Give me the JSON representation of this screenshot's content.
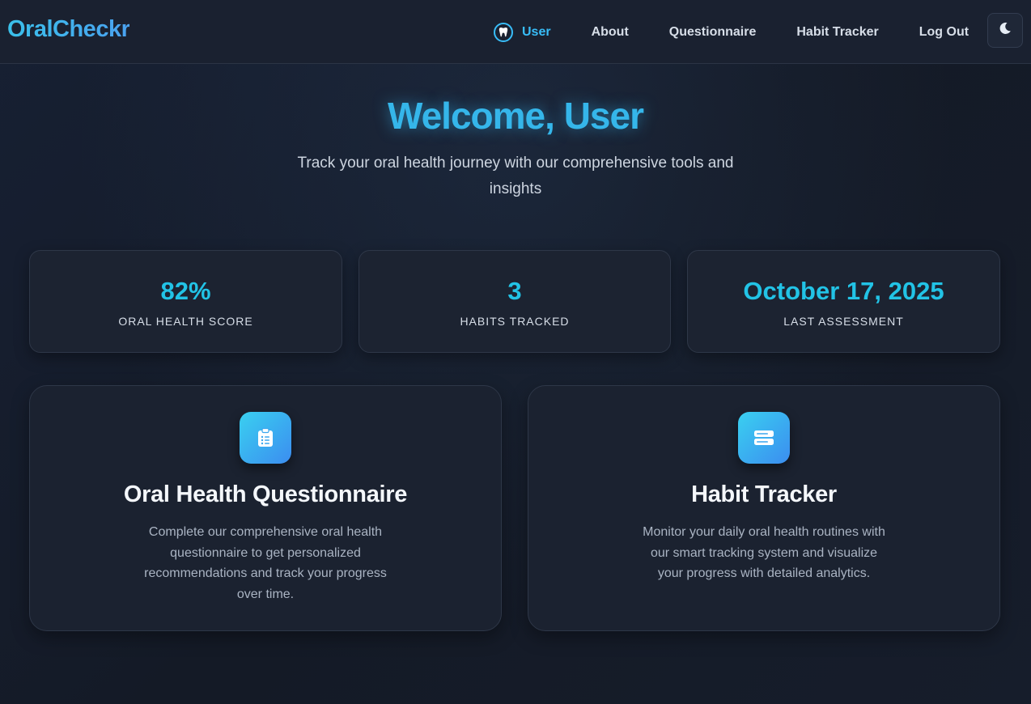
{
  "brand": "OralCheckr",
  "nav": {
    "user": "User",
    "about": "About",
    "questionnaire": "Questionnaire",
    "habit_tracker": "Habit Tracker",
    "logout": "Log Out"
  },
  "hero": {
    "title": "Welcome, User",
    "subtitle": "Track your oral health journey with our comprehensive tools and insights"
  },
  "stats": [
    {
      "value": "82%",
      "label": "Oral Health Score"
    },
    {
      "value": "3",
      "label": "Habits Tracked"
    },
    {
      "value": "October 17, 2025",
      "label": "Last Assessment"
    }
  ],
  "features": [
    {
      "title": "Oral Health Questionnaire",
      "description": "Complete our comprehensive oral health questionnaire to get personalized recommendations and track your progress over time.",
      "icon": "clipboard-icon"
    },
    {
      "title": "Habit Tracker",
      "description": "Monitor your daily oral health routines with our smart tracking system and visualize your progress with detailed analytics.",
      "icon": "server-list-icon"
    }
  ],
  "colors": {
    "accent": "#38bdf8",
    "background": "#151b28",
    "card": "#1c2331"
  }
}
